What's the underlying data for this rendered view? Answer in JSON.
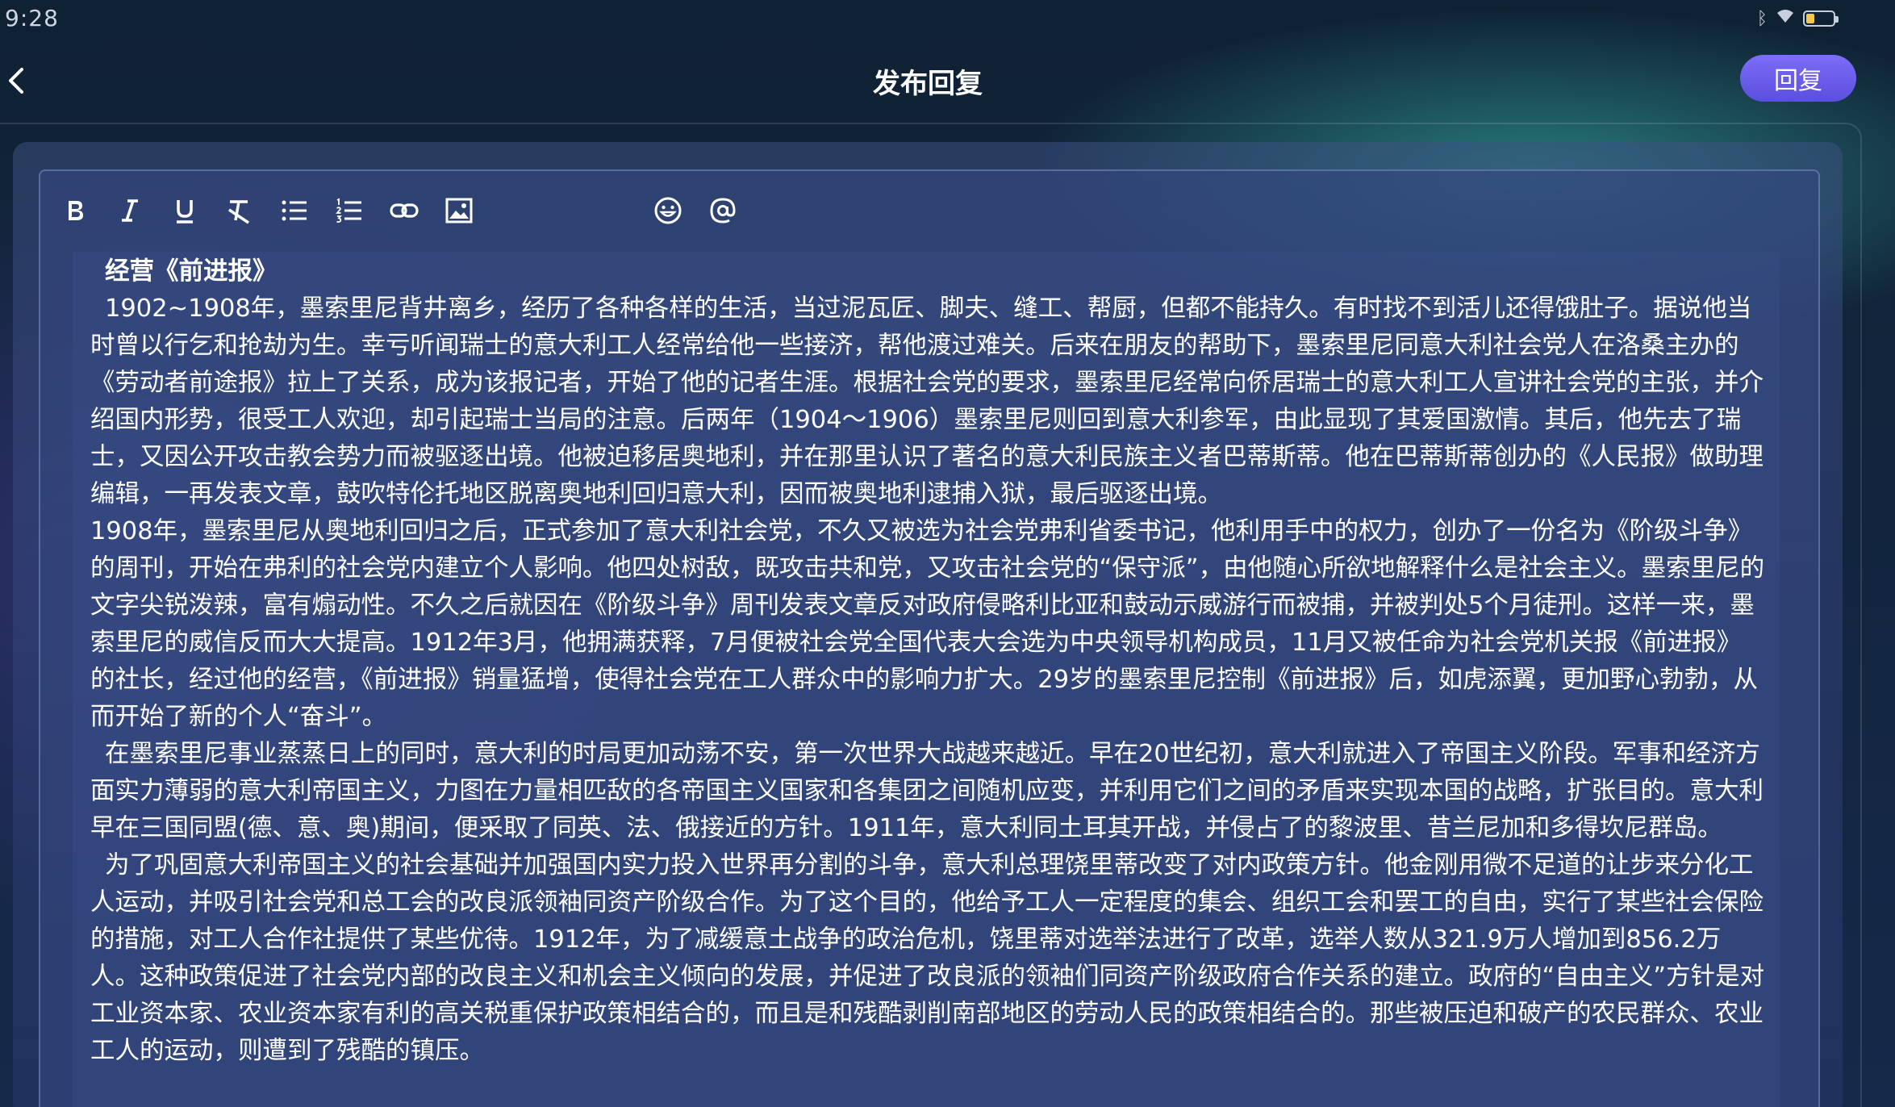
{
  "status_bar": {
    "time": "9:28",
    "icons": [
      "bluetooth-icon",
      "wifi-icon",
      "battery-icon"
    ]
  },
  "header": {
    "title": "发布回复",
    "reply_label": "回复"
  },
  "toolbar": {
    "buttons": [
      "bold-icon",
      "italic-icon",
      "underline-icon",
      "clear-format-icon",
      "bullet-list-icon",
      "numbered-list-icon",
      "link-icon",
      "image-icon",
      "emoji-icon",
      "mention-icon"
    ]
  },
  "editor": {
    "heading": "经营《前进报》",
    "paragraphs": [
      "1902~1908年，墨索里尼背井离乡，经历了各种各样的生活，当过泥瓦匠、脚夫、缝工、帮厨，但都不能持久。有时找不到活儿还得饿肚子。据说他当时曾以行乞和抢劫为生。幸亏听闻瑞士的意大利工人经常给他一些接济，帮他渡过难关。后来在朋友的帮助下，墨索里尼同意大利社会党人在洛桑主办的《劳动者前途报》拉上了关系，成为该报记者，开始了他的记者生涯。根据社会党的要求，墨索里尼经常向侨居瑞士的意大利工人宣讲社会党的主张，并介绍国内形势，很受工人欢迎，却引起瑞士当局的注意。后两年（1904～1906）墨索里尼则回到意大利参军，由此显现了其爱国激情。其后，他先去了瑞士，又因公开攻击教会势力而被驱逐出境。他被迫移居奥地利，并在那里认识了著名的意大利民族主义者巴蒂斯蒂。他在巴蒂斯蒂创办的《人民报》做助理编辑，一再发表文章，鼓吹特伦托地区脱离奥地利回归意大利，因而被奥地利逮捕入狱，最后驱逐出境。",
      "1908年，墨索里尼从奥地利回归之后，正式参加了意大利社会党，不久又被选为社会党弗利省委书记，他利用手中的权力，创办了一份名为《阶级斗争》的周刊，开始在弗利的社会党内建立个人影响。他四处树敌，既攻击共和党，又攻击社会党的“保守派”，由他随心所欲地解释什么是社会主义。墨索里尼的文字尖锐泼辣，富有煽动性。不久之后就因在《阶级斗争》周刊发表文章反对政府侵略利比亚和鼓动示威游行而被捕，并被判处5个月徒刑。这样一来，墨索里尼的威信反而大大提高。1912年3月，他拥满获释，7月便被社会党全国代表大会选为中央领导机构成员，11月又被任命为社会党机关报《前进报》的社长，经过他的经营，《前进报》销量猛增，使得社会党在工人群众中的影响力扩大。29岁的墨索里尼控制《前进报》后，如虎添翼，更加野心勃勃，从而开始了新的个人“奋斗”。",
      "在墨索里尼事业蒸蒸日上的同时，意大利的时局更加动荡不安，第一次世界大战越来越近。早在20世纪初，意大利就进入了帝国主义阶段。军事和经济方面实力薄弱的意大利帝国主义，力图在力量相匹敌的各帝国主义国家和各集团之间随机应变，并利用它们之间的矛盾来实现本国的战略，扩张目的。意大利早在三国同盟(德、意、奥)期间，便采取了同英、法、俄接近的方针。1911年，意大利同土耳其开战，并侵占了的黎波里、昔兰尼加和多得坎尼群岛。",
      "为了巩固意大利帝国主义的社会基础并加强国内实力投入世界再分割的斗争，意大利总理饶里蒂改变了对内政策方针。他金刚用微不足道的让步来分化工人运动，并吸引社会党和总工会的改良派领袖同资产阶级合作。为了这个目的，他给予工人一定程度的集会、组织工会和罢工的自由，实行了某些社会保险的措施，对工人合作社提供了某些优待。1912年，为了减缓意土战争的政治危机，饶里蒂对选举法进行了改革，选举人数从321.9万人增加到856.2万人。这种政策促进了社会党内部的改良主义和机会主义倾向的发展，并促进了改良派的领袖们同资产阶级政府合作关系的建立。政府的“自由主义”方针是对工业资本家、农业资本家有利的高关税重保护政策相结合的，而且是和残酷剥削南部地区的劳动人民的政策相结合的。那些被压迫和破产的农民群众、农业工人的运动，则遭到了残酷的镇压。"
    ]
  }
}
